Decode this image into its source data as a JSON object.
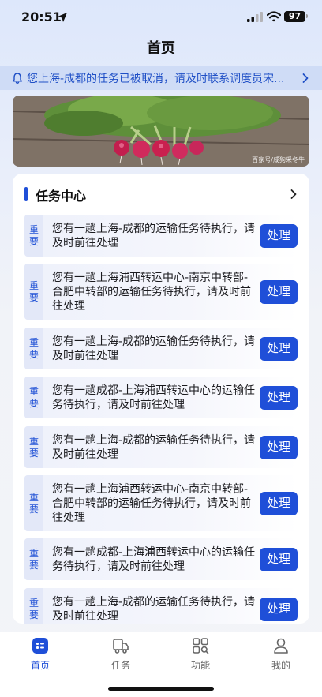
{
  "status": {
    "time": "20:51",
    "battery": "97"
  },
  "page_title": "首页",
  "notice": {
    "text": "您上海-成都的任务已被取消，请及时联系调度员宋..."
  },
  "banner": {
    "watermark": "百家号/咸狗采冬牛"
  },
  "task_center": {
    "title": "任务中心",
    "items": [
      {
        "tag": "重要",
        "text": "您有一趟上海-成都的运输任务待执行，请及时前往处理",
        "action": "处理"
      },
      {
        "tag": "重要",
        "text": "您有一趟上海浦西转运中心-南京中转部-合肥中转部的运输任务待执行，请及时前往处理",
        "action": "处理"
      },
      {
        "tag": "重要",
        "text": "您有一趟上海-成都的运输任务待执行，请及时前往处理",
        "action": "处理"
      },
      {
        "tag": "重要",
        "text": "您有一趟成都-上海浦西转运中心的运输任务待执行，请及时前往处理",
        "action": "处理"
      },
      {
        "tag": "重要",
        "text": "您有一趟上海-成都的运输任务待执行，请及时前往处理",
        "action": "处理"
      },
      {
        "tag": "重要",
        "text": "您有一趟上海浦西转运中心-南京中转部-合肥中转部的运输任务待执行，请及时前往处理",
        "action": "处理"
      },
      {
        "tag": "重要",
        "text": "您有一趟成都-上海浦西转运中心的运输任务待执行，请及时前往处理",
        "action": "处理"
      },
      {
        "tag": "重要",
        "text": "您有一趟上海-成都的运输任务待执行，请及时前往处理",
        "action": "处理"
      }
    ]
  },
  "tabs": [
    {
      "label": "首页",
      "icon": "home-icon",
      "active": true
    },
    {
      "label": "任务",
      "icon": "truck-icon",
      "active": false
    },
    {
      "label": "功能",
      "icon": "grid-search-icon",
      "active": false
    },
    {
      "label": "我的",
      "icon": "user-icon",
      "active": false
    }
  ],
  "colors": {
    "accent": "#1f4fd8",
    "notice_bg": "#cfdcf6",
    "notice_text": "#1f4fc6"
  }
}
